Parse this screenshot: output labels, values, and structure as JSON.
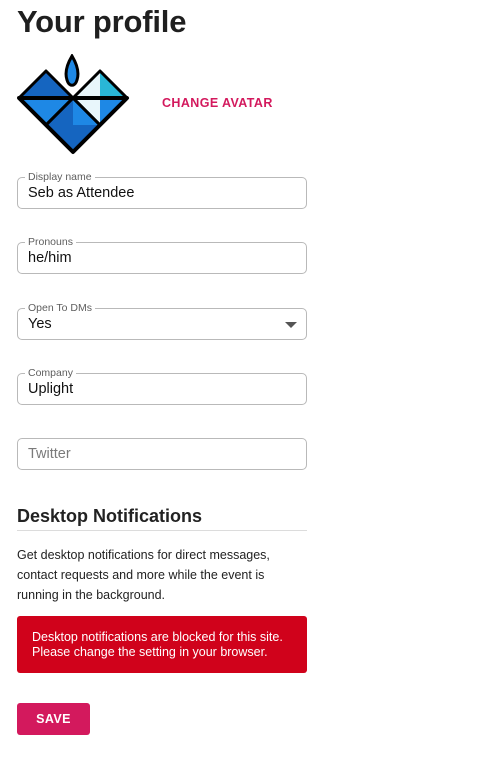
{
  "page": {
    "title": "Your profile"
  },
  "avatar": {
    "change_label": "CHANGE AVATAR"
  },
  "form": {
    "display_name": {
      "label": "Display name",
      "value": "Seb as Attendee"
    },
    "pronouns": {
      "label": "Pronouns",
      "value": "he/him"
    },
    "open_to_dms": {
      "label": "Open To DMs",
      "value": "Yes"
    },
    "company": {
      "label": "Company",
      "value": "Uplight"
    },
    "twitter": {
      "placeholder": "Twitter",
      "value": ""
    }
  },
  "notifications": {
    "heading": "Desktop Notifications",
    "description": "Get desktop notifications for direct messages, contact requests and more while the event is running in the background.",
    "alert_line1": "Desktop notifications are blocked for this site.",
    "alert_line2": "Please change the setting in your browser."
  },
  "actions": {
    "save_label": "SAVE"
  },
  "colors": {
    "accent": "#d3195d",
    "alert_bg": "#d0021b",
    "logo_blue": "#1e88e5",
    "logo_cyan": "#29b6d6"
  }
}
